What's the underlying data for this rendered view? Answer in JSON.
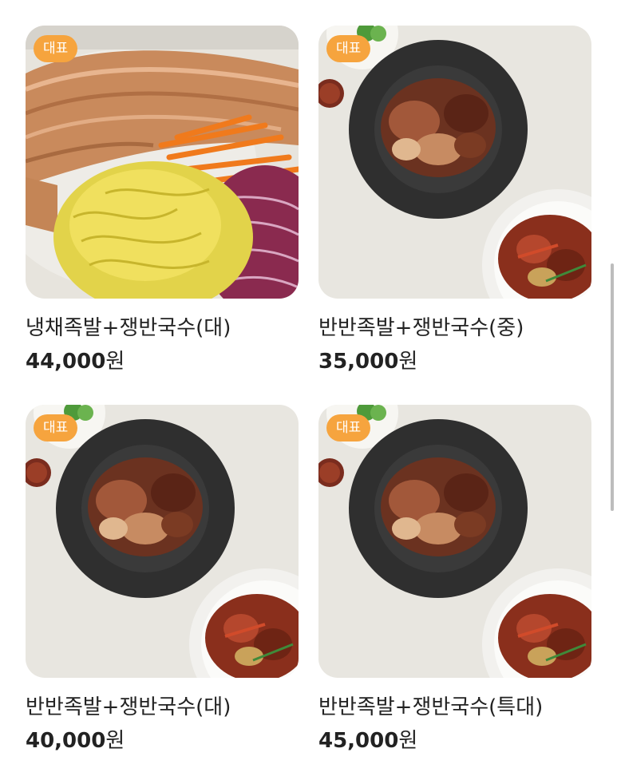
{
  "menu": {
    "items": [
      {
        "badge": "대표",
        "name": "냉채족발+쟁반국수(대)",
        "price": "44,000",
        "currency": "원",
        "photo_icon": "cold-jokbal-platter-icon"
      },
      {
        "badge": "대표",
        "name": "반반족발+쟁반국수(중)",
        "price": "35,000",
        "currency": "원",
        "photo_icon": "half-half-jokbal-plate-icon"
      },
      {
        "badge": "대표",
        "name": "반반족발+쟁반국수(대)",
        "price": "40,000",
        "currency": "원",
        "photo_icon": "half-half-jokbal-plate-icon"
      },
      {
        "badge": "대표",
        "name": "반반족발+쟁반국수(특대)",
        "price": "45,000",
        "currency": "원",
        "photo_icon": "half-half-jokbal-plate-icon"
      }
    ]
  },
  "colors": {
    "badge": "#f6a43e",
    "text": "#222222",
    "background": "#ffffff"
  }
}
